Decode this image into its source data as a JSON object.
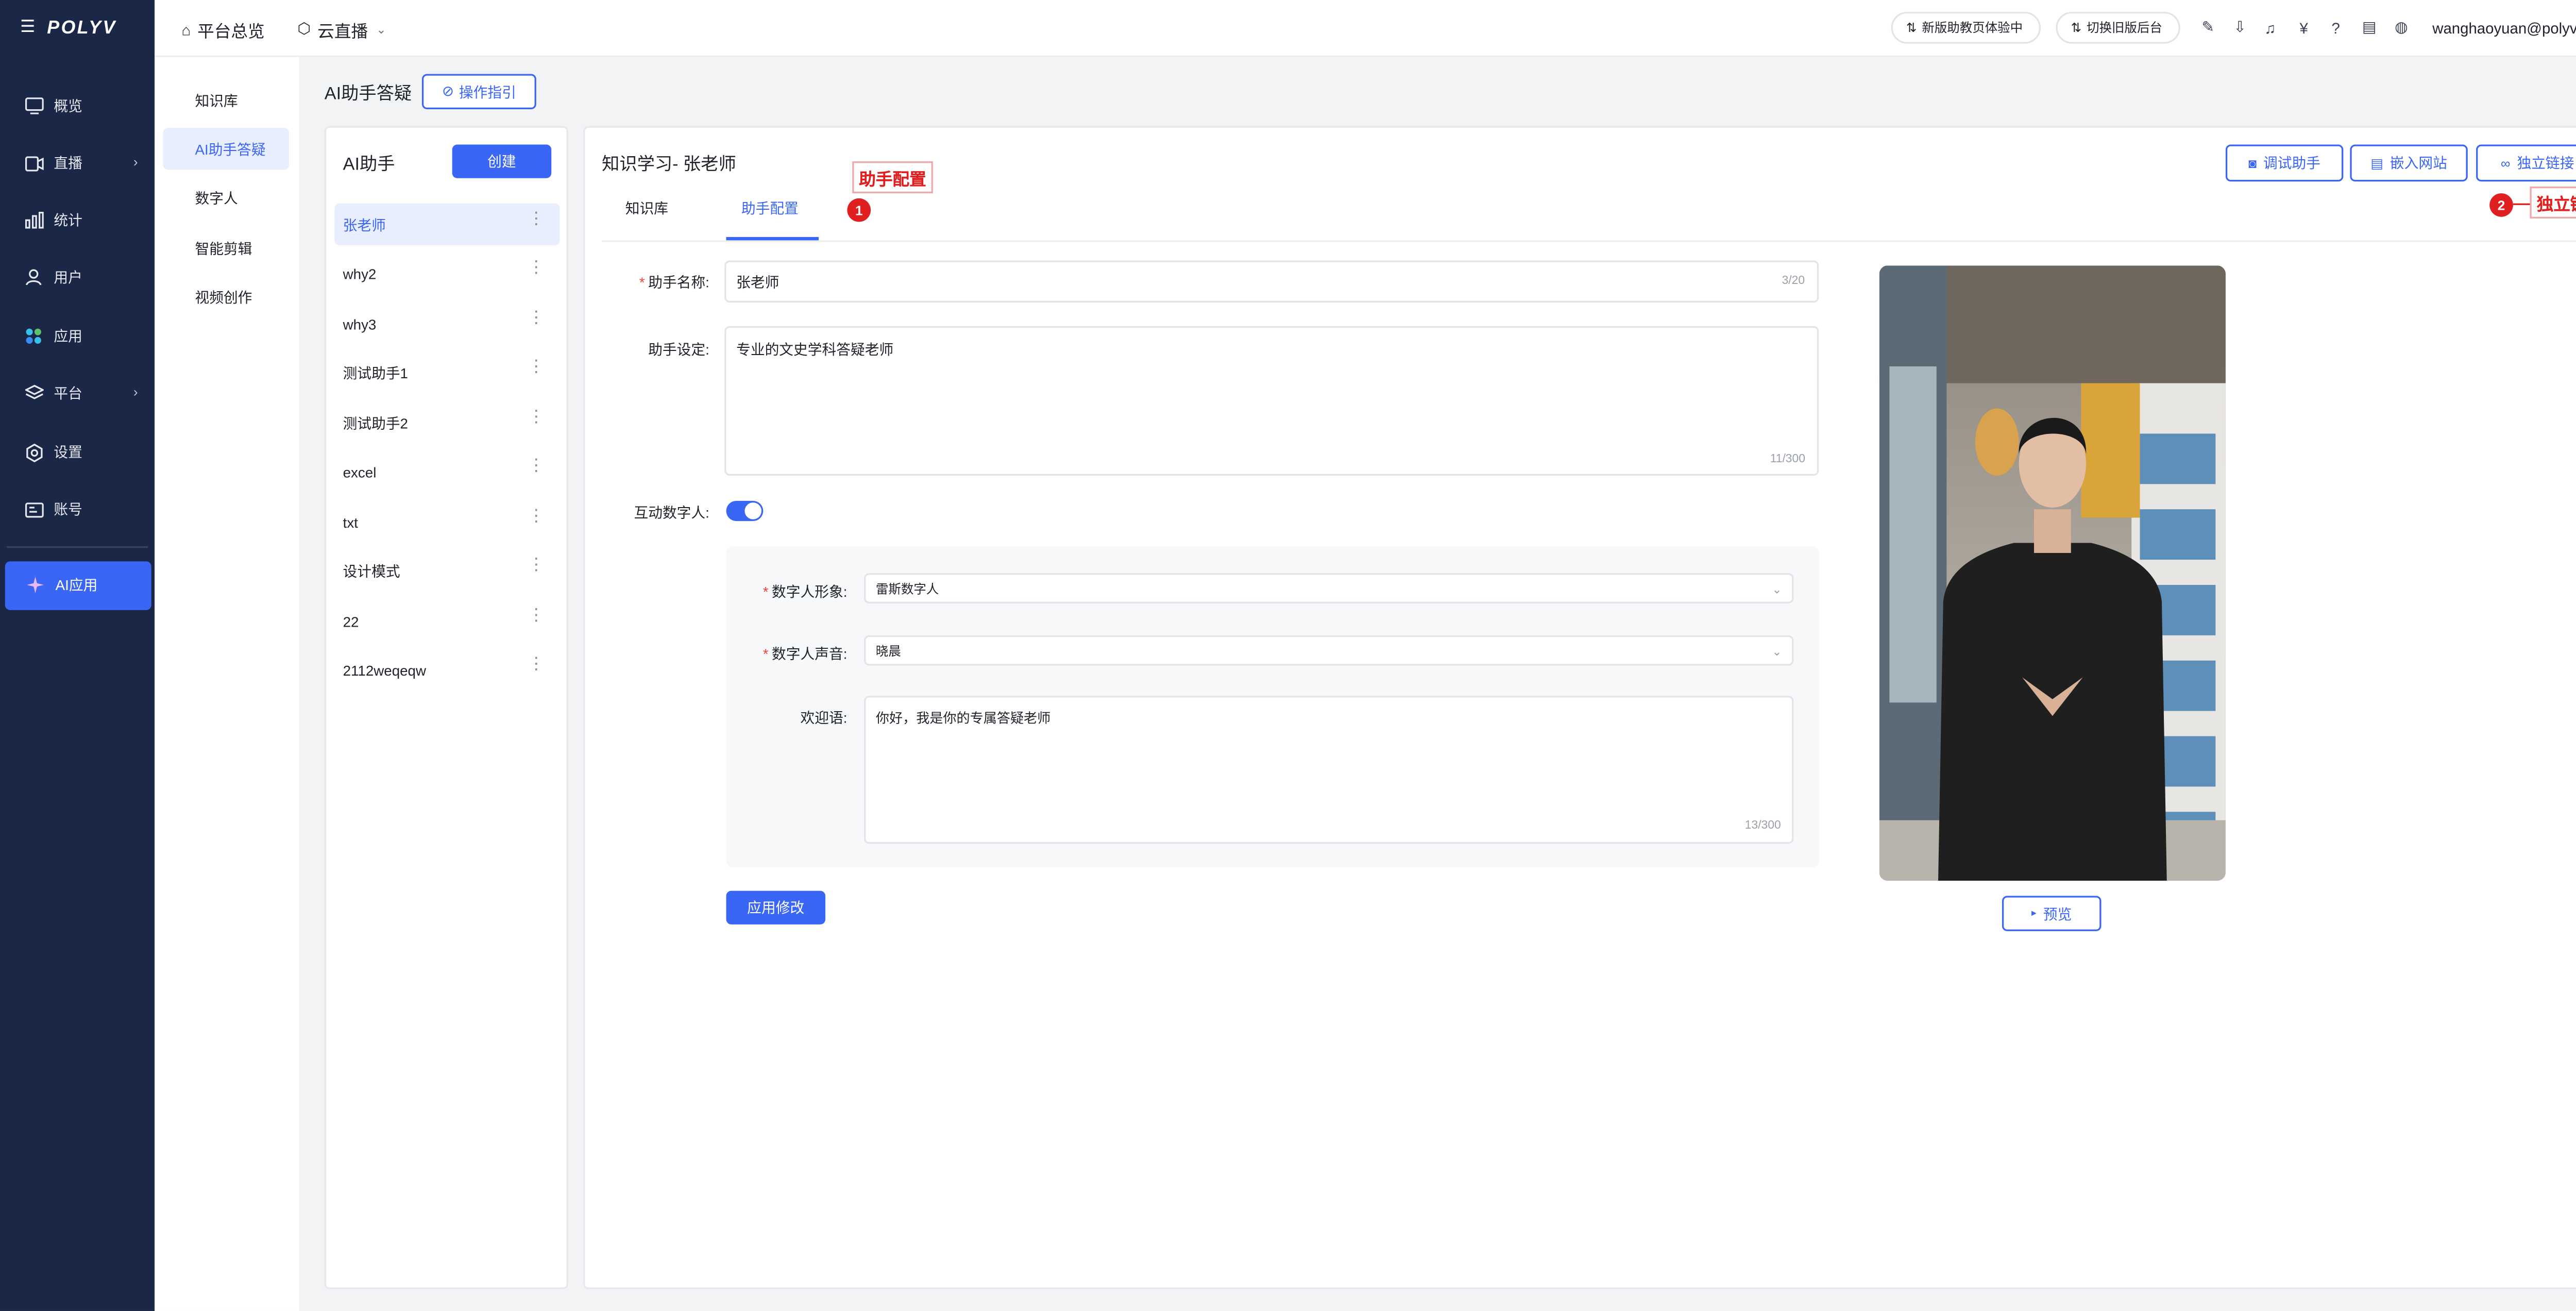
{
  "sidebar": {
    "logo": "POLYV",
    "items": [
      {
        "label": "概览",
        "icon": "monitor-icon"
      },
      {
        "label": "直播",
        "icon": "video-icon"
      },
      {
        "label": "统计",
        "icon": "bar-chart-icon"
      },
      {
        "label": "用户",
        "icon": "user-icon"
      },
      {
        "label": "应用",
        "icon": "apps-icon"
      },
      {
        "label": "平台",
        "icon": "layers-icon"
      },
      {
        "label": "设置",
        "icon": "gear-icon"
      },
      {
        "label": "账号",
        "icon": "id-card-icon"
      }
    ],
    "ai_app": "AI应用"
  },
  "topbar": {
    "tabs": [
      "平台总览",
      "云直播"
    ],
    "new_help": "新版助教页体验中",
    "switch_old": "切换旧版后台",
    "user_email": "wanghaoyuan@polyv.net"
  },
  "submenu": {
    "items": [
      "知识库",
      "AI助手答疑",
      "数字人",
      "智能剪辑",
      "视频创作"
    ],
    "active_index": 1
  },
  "page": {
    "title": "AI助手答疑",
    "guide_button": "操作指引"
  },
  "assistant_list": {
    "title": "AI助手",
    "create_button": "创建",
    "items": [
      "张老师",
      "why2",
      "why3",
      "测试助手1",
      "测试助手2",
      "excel",
      "txt",
      "设计模式",
      "22",
      "2112weqeqw"
    ],
    "active_index": 0
  },
  "main": {
    "title": "知识学习- 张老师",
    "tabs": [
      "知识库",
      "助手配置"
    ],
    "active_tab": 1,
    "buttons": {
      "debug": "调试助手",
      "embed": "嵌入网站",
      "link": "独立链接"
    },
    "form": {
      "name_label": "助手名称:",
      "name_value": "张老师",
      "name_counter": "3/20",
      "setting_label": "助手设定:",
      "setting_value": "专业的文史学科答疑老师",
      "setting_counter": "11/300",
      "digital_label": "互动数字人:",
      "digital_enabled": true,
      "avatar_label": "数字人形象:",
      "avatar_value": "雷斯数字人",
      "voice_label": "数字人声音:",
      "voice_value": "晓晨",
      "welcome_label": "欢迎语:",
      "welcome_value": "你好，我是你的专属答疑老师",
      "welcome_counter": "13/300",
      "apply_button": "应用修改"
    },
    "preview_button": "预览"
  },
  "annotations": {
    "a1_label": "助手配置",
    "a1_num": "1",
    "a2_label": "独立链接",
    "a2_num": "2"
  },
  "colors": {
    "sidebar_bg": "#1b2746",
    "accent": "#3a66f5",
    "annotation": "#e02020"
  }
}
